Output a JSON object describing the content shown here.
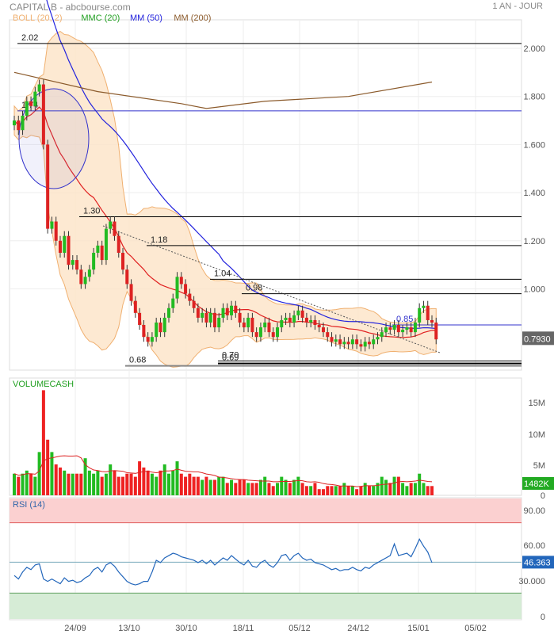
{
  "header": {
    "title": "CAPITAL B - abcbourse.com",
    "period": "1 AN - JOUR"
  },
  "chart_data": {
    "type": "candlestick",
    "legend": [
      {
        "label": "BOLL (20, 2)",
        "color": "#f0b070"
      },
      {
        "label": "MMC (20)",
        "color": "#22a022"
      },
      {
        "label": "MM (50)",
        "color": "#2222dd"
      },
      {
        "label": "MM (200)",
        "color": "#8b5a2b"
      }
    ],
    "x_ticks": [
      "24/09",
      "13/10",
      "30/10",
      "18/11",
      "05/12",
      "24/12",
      "15/01",
      "05/02"
    ],
    "price_ticks": [
      "2.000",
      "1.800",
      "1.600",
      "1.400",
      "1.200",
      "1.000"
    ],
    "last_price": "0.7930",
    "closes": [
      1.7,
      1.66,
      1.72,
      1.78,
      1.76,
      1.82,
      1.85,
      1.6,
      1.25,
      1.28,
      1.2,
      1.15,
      1.22,
      1.1,
      1.12,
      1.08,
      1.02,
      1.05,
      1.08,
      1.15,
      1.18,
      1.12,
      1.25,
      1.28,
      1.22,
      1.15,
      1.08,
      1.02,
      0.95,
      0.9,
      0.85,
      0.8,
      0.78,
      0.8,
      0.86,
      0.82,
      0.88,
      0.92,
      0.96,
      1.05,
      1.02,
      0.98,
      0.95,
      0.92,
      0.88,
      0.9,
      0.86,
      0.9,
      0.84,
      0.88,
      0.92,
      0.89,
      0.93,
      0.9,
      0.86,
      0.84,
      0.88,
      0.82,
      0.8,
      0.84,
      0.86,
      0.82,
      0.8,
      0.84,
      0.87,
      0.88,
      0.86,
      0.89,
      0.91,
      0.88,
      0.86,
      0.87,
      0.85,
      0.84,
      0.82,
      0.8,
      0.78,
      0.79,
      0.77,
      0.78,
      0.77,
      0.79,
      0.77,
      0.76,
      0.78,
      0.77,
      0.79,
      0.8,
      0.82,
      0.84,
      0.83,
      0.85,
      0.82,
      0.83,
      0.84,
      0.82,
      0.86,
      0.92,
      0.93,
      0.87,
      0.86,
      0.79
    ],
    "mm200": [
      [
        0,
        1.9
      ],
      [
        20,
        1.82
      ],
      [
        40,
        1.77
      ],
      [
        46,
        1.75
      ],
      [
        60,
        1.78
      ],
      [
        80,
        1.8
      ],
      [
        100,
        1.86
      ]
    ],
    "annotations": [
      {
        "value": 2.02,
        "label": "2.02",
        "color": "#000"
      },
      {
        "value": 1.74,
        "label": "1.74",
        "color": "#3333cc"
      },
      {
        "value": 1.3,
        "label": "1.30",
        "color": "#000"
      },
      {
        "value": 1.18,
        "label": "1.18",
        "color": "#000"
      },
      {
        "value": 1.04,
        "label": "1.04",
        "color": "#000"
      },
      {
        "value": 0.98,
        "label": "0.98",
        "color": "#000"
      },
      {
        "value": 0.85,
        "label": "0.85",
        "color": "#3333cc"
      },
      {
        "value": 0.7,
        "label": "0.70",
        "color": "#000"
      },
      {
        "value": 0.69,
        "label": "0.69",
        "color": "#000"
      },
      {
        "value": 0.68,
        "label": "0.68",
        "color": "#888"
      }
    ],
    "volume": {
      "label": "VOLUMECASH",
      "ticks": [
        "15M",
        "10M",
        "5M",
        "0"
      ],
      "last": "1482K",
      "values": [
        3.5,
        3,
        3.5,
        4,
        3.5,
        3,
        7,
        17,
        9,
        7,
        5,
        4.5,
        4,
        3.5,
        3.5,
        3.5,
        3.5,
        6,
        4,
        3.5,
        4,
        3,
        3.5,
        5,
        4,
        3,
        3,
        3.5,
        3.5,
        3,
        5.5,
        4.5,
        4,
        3.5,
        3,
        4,
        5,
        3.5,
        4,
        5.5,
        3.5,
        3,
        3.5,
        3,
        3,
        2.5,
        3,
        2.5,
        2.5,
        3,
        3,
        2,
        2.5,
        2,
        2.5,
        2.5,
        2,
        2,
        2,
        2.5,
        3,
        2,
        1.5,
        2,
        3,
        2.5,
        2,
        2.5,
        3,
        2,
        1.5,
        1.5,
        2,
        1,
        1,
        1.5,
        1.5,
        1.5,
        1.5,
        2,
        1.5,
        1.5,
        1,
        1.5,
        2,
        1.5,
        1.5,
        2,
        3,
        2.5,
        2,
        3,
        3,
        2,
        1.5,
        2,
        2,
        3.5,
        2,
        1.5,
        1.5
      ]
    },
    "rsi": {
      "label": "RSI (14)",
      "ticks": [
        "90.00",
        "60.00",
        "30.000",
        "0"
      ],
      "last": "46.363",
      "values": [
        35,
        32,
        38,
        42,
        40,
        44,
        45,
        32,
        30,
        32,
        30,
        28,
        33,
        30,
        31,
        29,
        30,
        33,
        35,
        40,
        42,
        38,
        44,
        46,
        43,
        38,
        34,
        30,
        28,
        27,
        28,
        30,
        30,
        38,
        48,
        46,
        50,
        52,
        54,
        53,
        51,
        50,
        49,
        48,
        46,
        48,
        45,
        48,
        44,
        47,
        50,
        48,
        52,
        49,
        46,
        44,
        48,
        43,
        42,
        46,
        48,
        44,
        42,
        46,
        52,
        53,
        48,
        52,
        54,
        50,
        48,
        49,
        46,
        45,
        44,
        42,
        40,
        41,
        39,
        40,
        40,
        42,
        40,
        39,
        42,
        41,
        44,
        46,
        48,
        50,
        52,
        62,
        52,
        53,
        54,
        51,
        58,
        66,
        60,
        55,
        46
      ]
    }
  }
}
